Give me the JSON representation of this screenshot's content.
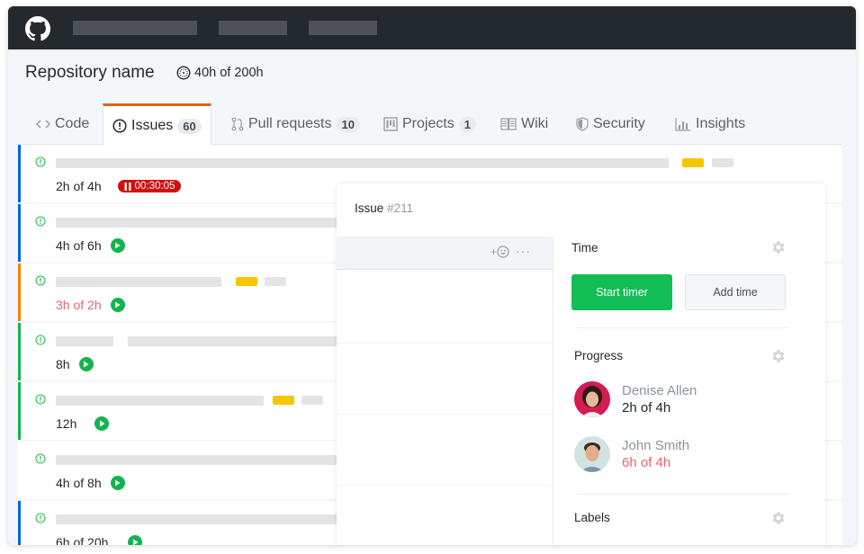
{
  "header": {
    "repo_name": "Repository name",
    "repo_time": "40h of 200h"
  },
  "tabs": [
    {
      "label": "Code",
      "icon": "code-icon",
      "count": null,
      "active": false
    },
    {
      "label": "Issues",
      "icon": "issue-icon",
      "count": "60",
      "active": true
    },
    {
      "label": "Pull requests",
      "icon": "pull-request-icon",
      "count": "10",
      "active": false
    },
    {
      "label": "Projects",
      "icon": "project-icon",
      "count": "1",
      "active": false
    },
    {
      "label": "Wiki",
      "icon": "book-icon",
      "count": null,
      "active": false
    },
    {
      "label": "Security",
      "icon": "shield-icon",
      "count": null,
      "active": false
    },
    {
      "label": "Insights",
      "icon": "graph-icon",
      "count": null,
      "active": false
    }
  ],
  "issues": [
    {
      "time": "2h of 4h",
      "over_budget": false,
      "status_color": "#0366d6",
      "timer_running": true,
      "timer": "00:30:05"
    },
    {
      "time": "4h of 6h",
      "over_budget": false,
      "status_color": "#0366d6",
      "timer_running": false
    },
    {
      "time": "3h of 2h",
      "over_budget": true,
      "status_color": "#f6820c",
      "timer_running": false
    },
    {
      "time": "8h",
      "over_budget": false,
      "status_color": "#12b54d",
      "timer_running": false
    },
    {
      "time": "12h",
      "over_budget": false,
      "status_color": "#12b54d",
      "timer_running": false
    },
    {
      "time": "4h of 8h",
      "over_budget": false,
      "status_color": null,
      "timer_running": false
    },
    {
      "time": "6h of 20h",
      "over_budget": false,
      "status_color": "#0366d6",
      "timer_running": false
    }
  ],
  "panel": {
    "title": "Issue",
    "number": "#211",
    "reaction_label": "+",
    "more_label": "···",
    "time_section": {
      "title": "Time",
      "start_button": "Start timer",
      "add_button": "Add time"
    },
    "progress_section": {
      "title": "Progress",
      "people": [
        {
          "name": "Denise Allen",
          "time": "2h of 4h",
          "over_budget": false
        },
        {
          "name": "John Smith",
          "time": "6h of 4h",
          "over_budget": true
        }
      ]
    },
    "labels_section": {
      "title": "Labels"
    }
  },
  "colors": {
    "accent_tab": "#e36209",
    "play_green": "#12b54d",
    "start_green": "#12bd55",
    "timer_red": "#d10f0f",
    "over_budget": "#f0626f",
    "label_yellow": "#f7c600"
  }
}
